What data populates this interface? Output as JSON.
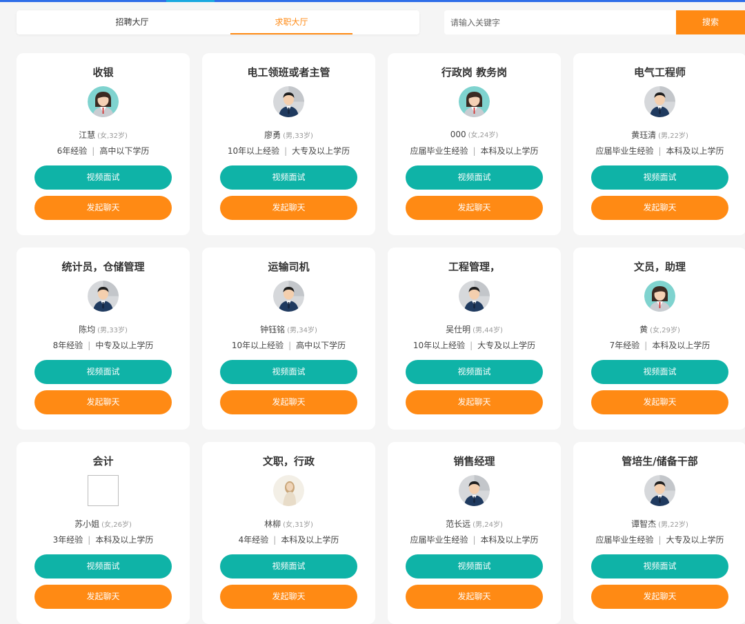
{
  "tabs": [
    {
      "label": "招聘大厅",
      "active": false
    },
    {
      "label": "求职大厅",
      "active": true
    }
  ],
  "search": {
    "placeholder": "请输入关键字",
    "button_label": "搜索"
  },
  "colors": {
    "accent_orange": "#ff8a14",
    "accent_teal": "#0fb3a7",
    "top_bar_blue": "#2f6ee8"
  },
  "cards": [
    {
      "title": "收银",
      "name": "江慧",
      "meta": "(女,32岁)",
      "experience": "6年经验",
      "education": "高中以下学历",
      "avatar": "female-avatar-icon",
      "video_label": "视频面试",
      "chat_label": "发起聊天"
    },
    {
      "title": "电工领班或者主管",
      "name": "廖勇",
      "meta": "(男,33岁)",
      "experience": "10年以上经验",
      "education": "大专及以上学历",
      "avatar": "male-avatar-icon",
      "video_label": "视频面试",
      "chat_label": "发起聊天"
    },
    {
      "title": "行政岗 教务岗",
      "name": "000",
      "meta": "(女,24岁)",
      "experience": "应届毕业生经验",
      "education": "本科及以上学历",
      "avatar": "female-avatar-icon",
      "video_label": "视频面试",
      "chat_label": "发起聊天"
    },
    {
      "title": "电气工程师",
      "name": "黄珏清",
      "meta": "(男,22岁)",
      "experience": "应届毕业生经验",
      "education": "本科及以上学历",
      "avatar": "male-avatar-icon",
      "video_label": "视频面试",
      "chat_label": "发起聊天"
    },
    {
      "title": "统计员，仓储管理",
      "name": "陈均",
      "meta": "(男,33岁)",
      "experience": "8年经验",
      "education": "中专及以上学历",
      "avatar": "male-avatar-icon",
      "video_label": "视频面试",
      "chat_label": "发起聊天"
    },
    {
      "title": "运输司机",
      "name": "钟钰铭",
      "meta": "(男,34岁)",
      "experience": "10年以上经验",
      "education": "高中以下学历",
      "avatar": "male-avatar-icon",
      "video_label": "视频面试",
      "chat_label": "发起聊天"
    },
    {
      "title": "工程管理，",
      "name": "吴仕明",
      "meta": "(男,44岁)",
      "experience": "10年以上经验",
      "education": "大专及以上学历",
      "avatar": "male-avatar-icon",
      "video_label": "视频面试",
      "chat_label": "发起聊天"
    },
    {
      "title": "文员，助理",
      "name": "黄",
      "meta": "(女,29岁)",
      "experience": "7年经验",
      "education": "本科及以上学历",
      "avatar": "female-avatar-icon",
      "video_label": "视频面试",
      "chat_label": "发起聊天"
    },
    {
      "title": "会计",
      "name": "苏小姐",
      "meta": "(女,26岁)",
      "experience": "3年经验",
      "education": "本科及以上学历",
      "avatar": "broken-image-icon",
      "video_label": "视频面试",
      "chat_label": "发起聊天"
    },
    {
      "title": "文职，行政",
      "name": "林柳",
      "meta": "(女,31岁)",
      "experience": "4年经验",
      "education": "本科及以上学历",
      "avatar": "photo-avatar-icon",
      "video_label": "视频面试",
      "chat_label": "发起聊天"
    },
    {
      "title": "销售经理",
      "name": "范长远",
      "meta": "(男,24岁)",
      "experience": "应届毕业生经验",
      "education": "本科及以上学历",
      "avatar": "male-avatar-icon",
      "video_label": "视频面试",
      "chat_label": "发起聊天"
    },
    {
      "title": "管培生/储备干部",
      "name": "谭智杰",
      "meta": "(男,22岁)",
      "experience": "应届毕业生经验",
      "education": "大专及以上学历",
      "avatar": "male-avatar-icon",
      "video_label": "视频面试",
      "chat_label": "发起聊天"
    }
  ]
}
